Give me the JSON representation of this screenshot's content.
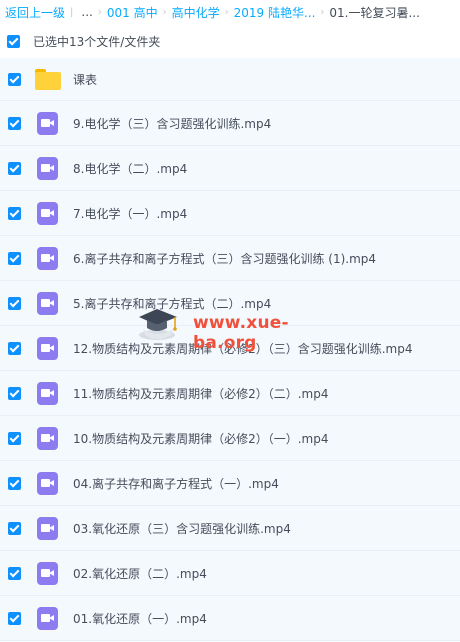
{
  "breadcrumb": {
    "back": "返回上一级",
    "ellipsis": "...",
    "items": [
      "001 高中",
      "高中化学",
      "2019 陆艳华...",
      "01.一轮复习暑..."
    ]
  },
  "selection": {
    "label": "已选中13个文件/文件夹"
  },
  "files": [
    {
      "name": "课表",
      "type": "folder"
    },
    {
      "name": "9.电化学（三）含习题强化训练.mp4",
      "type": "video"
    },
    {
      "name": "8.电化学（二）.mp4",
      "type": "video"
    },
    {
      "name": "7.电化学（一）.mp4",
      "type": "video"
    },
    {
      "name": "6.离子共存和离子方程式（三）含习题强化训练 (1).mp4",
      "type": "video"
    },
    {
      "name": "5.离子共存和离子方程式（二）.mp4",
      "type": "video"
    },
    {
      "name": "12.物质结构及元素周期律（必修2）（三）含习题强化训练.mp4",
      "type": "video"
    },
    {
      "name": "11.物质结构及元素周期律（必修2）（二）.mp4",
      "type": "video"
    },
    {
      "name": "10.物质结构及元素周期律（必修2）（一）.mp4",
      "type": "video"
    },
    {
      "name": "04.离子共存和离子方程式（一）.mp4",
      "type": "video"
    },
    {
      "name": "03.氧化还原（三）含习题强化训练.mp4",
      "type": "video"
    },
    {
      "name": "02.氧化还原（二）.mp4",
      "type": "video"
    },
    {
      "name": "01.氧化还原（一）.mp4",
      "type": "video"
    }
  ],
  "watermark": {
    "text": "www.xue-ba.org"
  },
  "colors": {
    "link": "#09aaff",
    "checkbox": "#0f90ff",
    "video_icon": "#8c7cf0",
    "folder": "#ffd13b",
    "watermark": "#f0513c"
  }
}
